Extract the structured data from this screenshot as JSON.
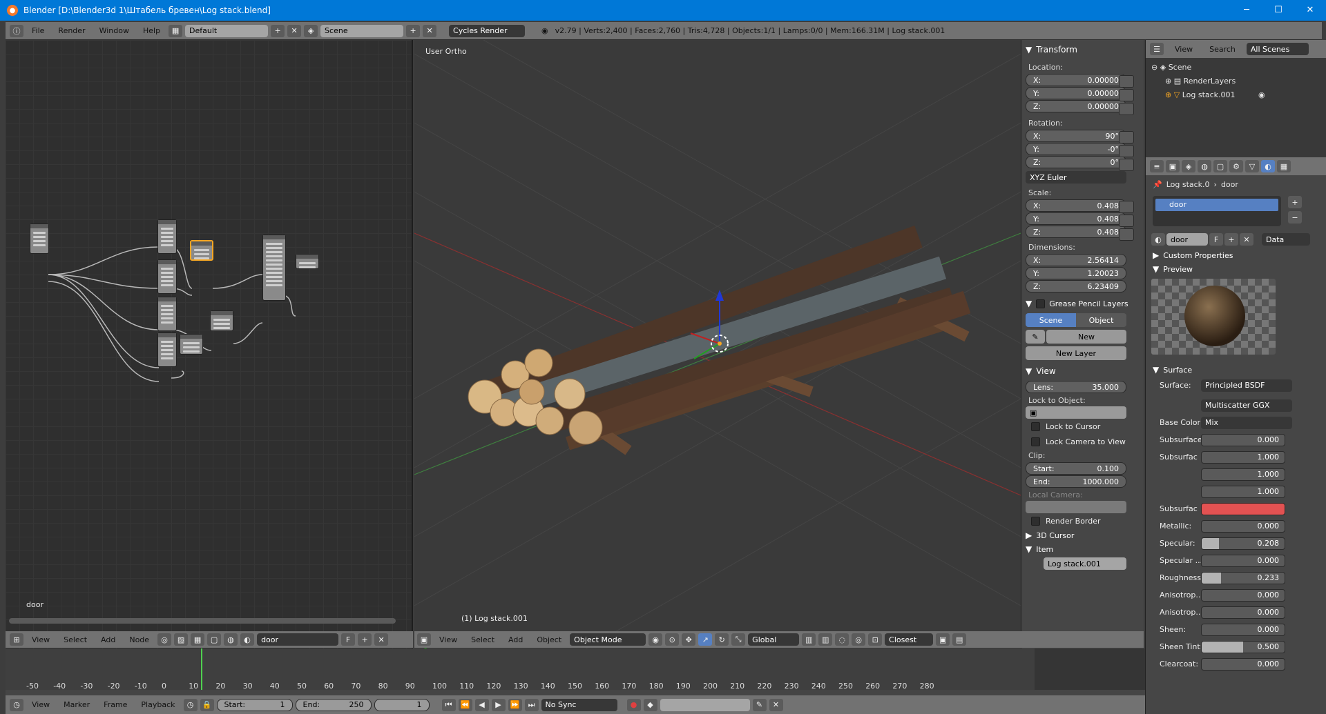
{
  "window": {
    "title": "Blender [D:\\Blender3d 1\\Штабель бревен\\Log stack.blend]",
    "minimize": "─",
    "maximize": "☐",
    "close": "✕"
  },
  "topbar": {
    "menus": [
      "File",
      "Render",
      "Window",
      "Help"
    ],
    "layout": "Default",
    "scene": "Scene",
    "engine": "Cycles Render",
    "stats": "v2.79 | Verts:2,400 | Faces:2,760 | Tris:4,728 | Objects:1/1 | Lamps:0/0 | Mem:166.31M | Log stack.001"
  },
  "node_editor": {
    "material_label": "door",
    "header": {
      "menus": [
        "View",
        "Select",
        "Add",
        "Node"
      ],
      "material": "door",
      "fake": "F"
    }
  },
  "viewport": {
    "view_label": "User Ortho",
    "object_label": "(1) Log stack.001",
    "header": {
      "menus": [
        "View",
        "Select",
        "Add",
        "Object"
      ],
      "mode": "Object Mode",
      "orientation": "Global",
      "snap": "Closest"
    }
  },
  "npanel": {
    "transform_title": "Transform",
    "location_label": "Location:",
    "location": [
      {
        "axis": "X:",
        "value": "0.00000"
      },
      {
        "axis": "Y:",
        "value": "0.00000"
      },
      {
        "axis": "Z:",
        "value": "0.00000"
      }
    ],
    "rotation_label": "Rotation:",
    "rotation": [
      {
        "axis": "X:",
        "value": "90°"
      },
      {
        "axis": "Y:",
        "value": "-0°"
      },
      {
        "axis": "Z:",
        "value": "0°"
      }
    ],
    "euler": "XYZ Euler",
    "scale_label": "Scale:",
    "scale": [
      {
        "axis": "X:",
        "value": "0.408"
      },
      {
        "axis": "Y:",
        "value": "0.408"
      },
      {
        "axis": "Z:",
        "value": "0.408"
      }
    ],
    "dimensions_label": "Dimensions:",
    "dimensions": [
      {
        "axis": "X:",
        "value": "2.56414"
      },
      {
        "axis": "Y:",
        "value": "1.20023"
      },
      {
        "axis": "Z:",
        "value": "6.23409"
      }
    ],
    "gp_title": "Grease Pencil Layers",
    "gp_scene": "Scene",
    "gp_object": "Object",
    "gp_new": "New",
    "gp_new_layer": "New Layer",
    "view_title": "View",
    "lens_label": "Lens:",
    "lens": "35.000",
    "lock_obj_label": "Lock to Object:",
    "lock_cursor": "Lock to Cursor",
    "lock_camera": "Lock Camera to View",
    "clip_label": "Clip:",
    "clip_start_label": "Start:",
    "clip_start": "0.100",
    "clip_end_label": "End:",
    "clip_end": "1000.000",
    "local_camera": "Local Camera:",
    "render_border": "Render Border",
    "cursor_title": "3D Cursor",
    "item_title": "Item",
    "item_name": "Log stack.001"
  },
  "outliner": {
    "menus": [
      "View",
      "Search"
    ],
    "filter": "All Scenes",
    "items": [
      "Scene",
      "RenderLayers",
      "Log stack.001"
    ]
  },
  "properties": {
    "breadcrumb_obj": "Log stack.0",
    "breadcrumb_mat": "door",
    "slot": "door",
    "mat_name": "door",
    "fake": "F",
    "link": "Data",
    "custom_props": "Custom Properties",
    "preview": "Preview",
    "surface_title": "Surface",
    "surface_label": "Surface:",
    "surface_value": "Principled BSDF",
    "distribution": "Multiscatter GGX",
    "base_color_label": "Base Color:",
    "base_color_value": "Mix",
    "rows": [
      {
        "label": "Subsurface:",
        "value": "0.000",
        "fill": 0
      },
      {
        "label": "Subsurfac",
        "value": "1.000",
        "fill": 0
      },
      {
        "label": "",
        "value": "1.000",
        "fill": 0
      },
      {
        "label": "",
        "value": "1.000",
        "fill": 0
      },
      {
        "label": "Subsurfac",
        "value": "",
        "fill": 0
      },
      {
        "label": "Metallic:",
        "value": "0.000",
        "fill": 0
      },
      {
        "label": "Specular:",
        "value": "0.208",
        "fill": 0.208
      },
      {
        "label": "Specular ...",
        "value": "0.000",
        "fill": 0
      },
      {
        "label": "Roughness:",
        "value": "0.233",
        "fill": 0.233
      },
      {
        "label": "Anisotrop...",
        "value": "0.000",
        "fill": 0
      },
      {
        "label": "Anisotrop...",
        "value": "0.000",
        "fill": 0
      },
      {
        "label": "Sheen:",
        "value": "0.000",
        "fill": 0
      },
      {
        "label": "Sheen Tint:",
        "value": "0.500",
        "fill": 0.5
      },
      {
        "label": "Clearcoat:",
        "value": "0.000",
        "fill": 0
      }
    ],
    "subsurface_color": "#e35252"
  },
  "timeline": {
    "ticks": [
      "-50",
      "-40",
      "-30",
      "-20",
      "-10",
      "0",
      "10",
      "20",
      "30",
      "40",
      "50",
      "60",
      "70",
      "80",
      "90",
      "100",
      "110",
      "120",
      "130",
      "140",
      "150",
      "160",
      "170",
      "180",
      "190",
      "200",
      "210",
      "220",
      "230",
      "240",
      "250",
      "260",
      "270",
      "280"
    ],
    "footer_menus": [
      "View",
      "Marker",
      "Frame",
      "Playback"
    ],
    "start_label": "Start:",
    "start": "1",
    "end_label": "End:",
    "end": "250",
    "current": "1",
    "sync": "No Sync"
  },
  "colors": {
    "accent": "#0078d7",
    "selection": "#f5a623",
    "panel": "#464646"
  }
}
